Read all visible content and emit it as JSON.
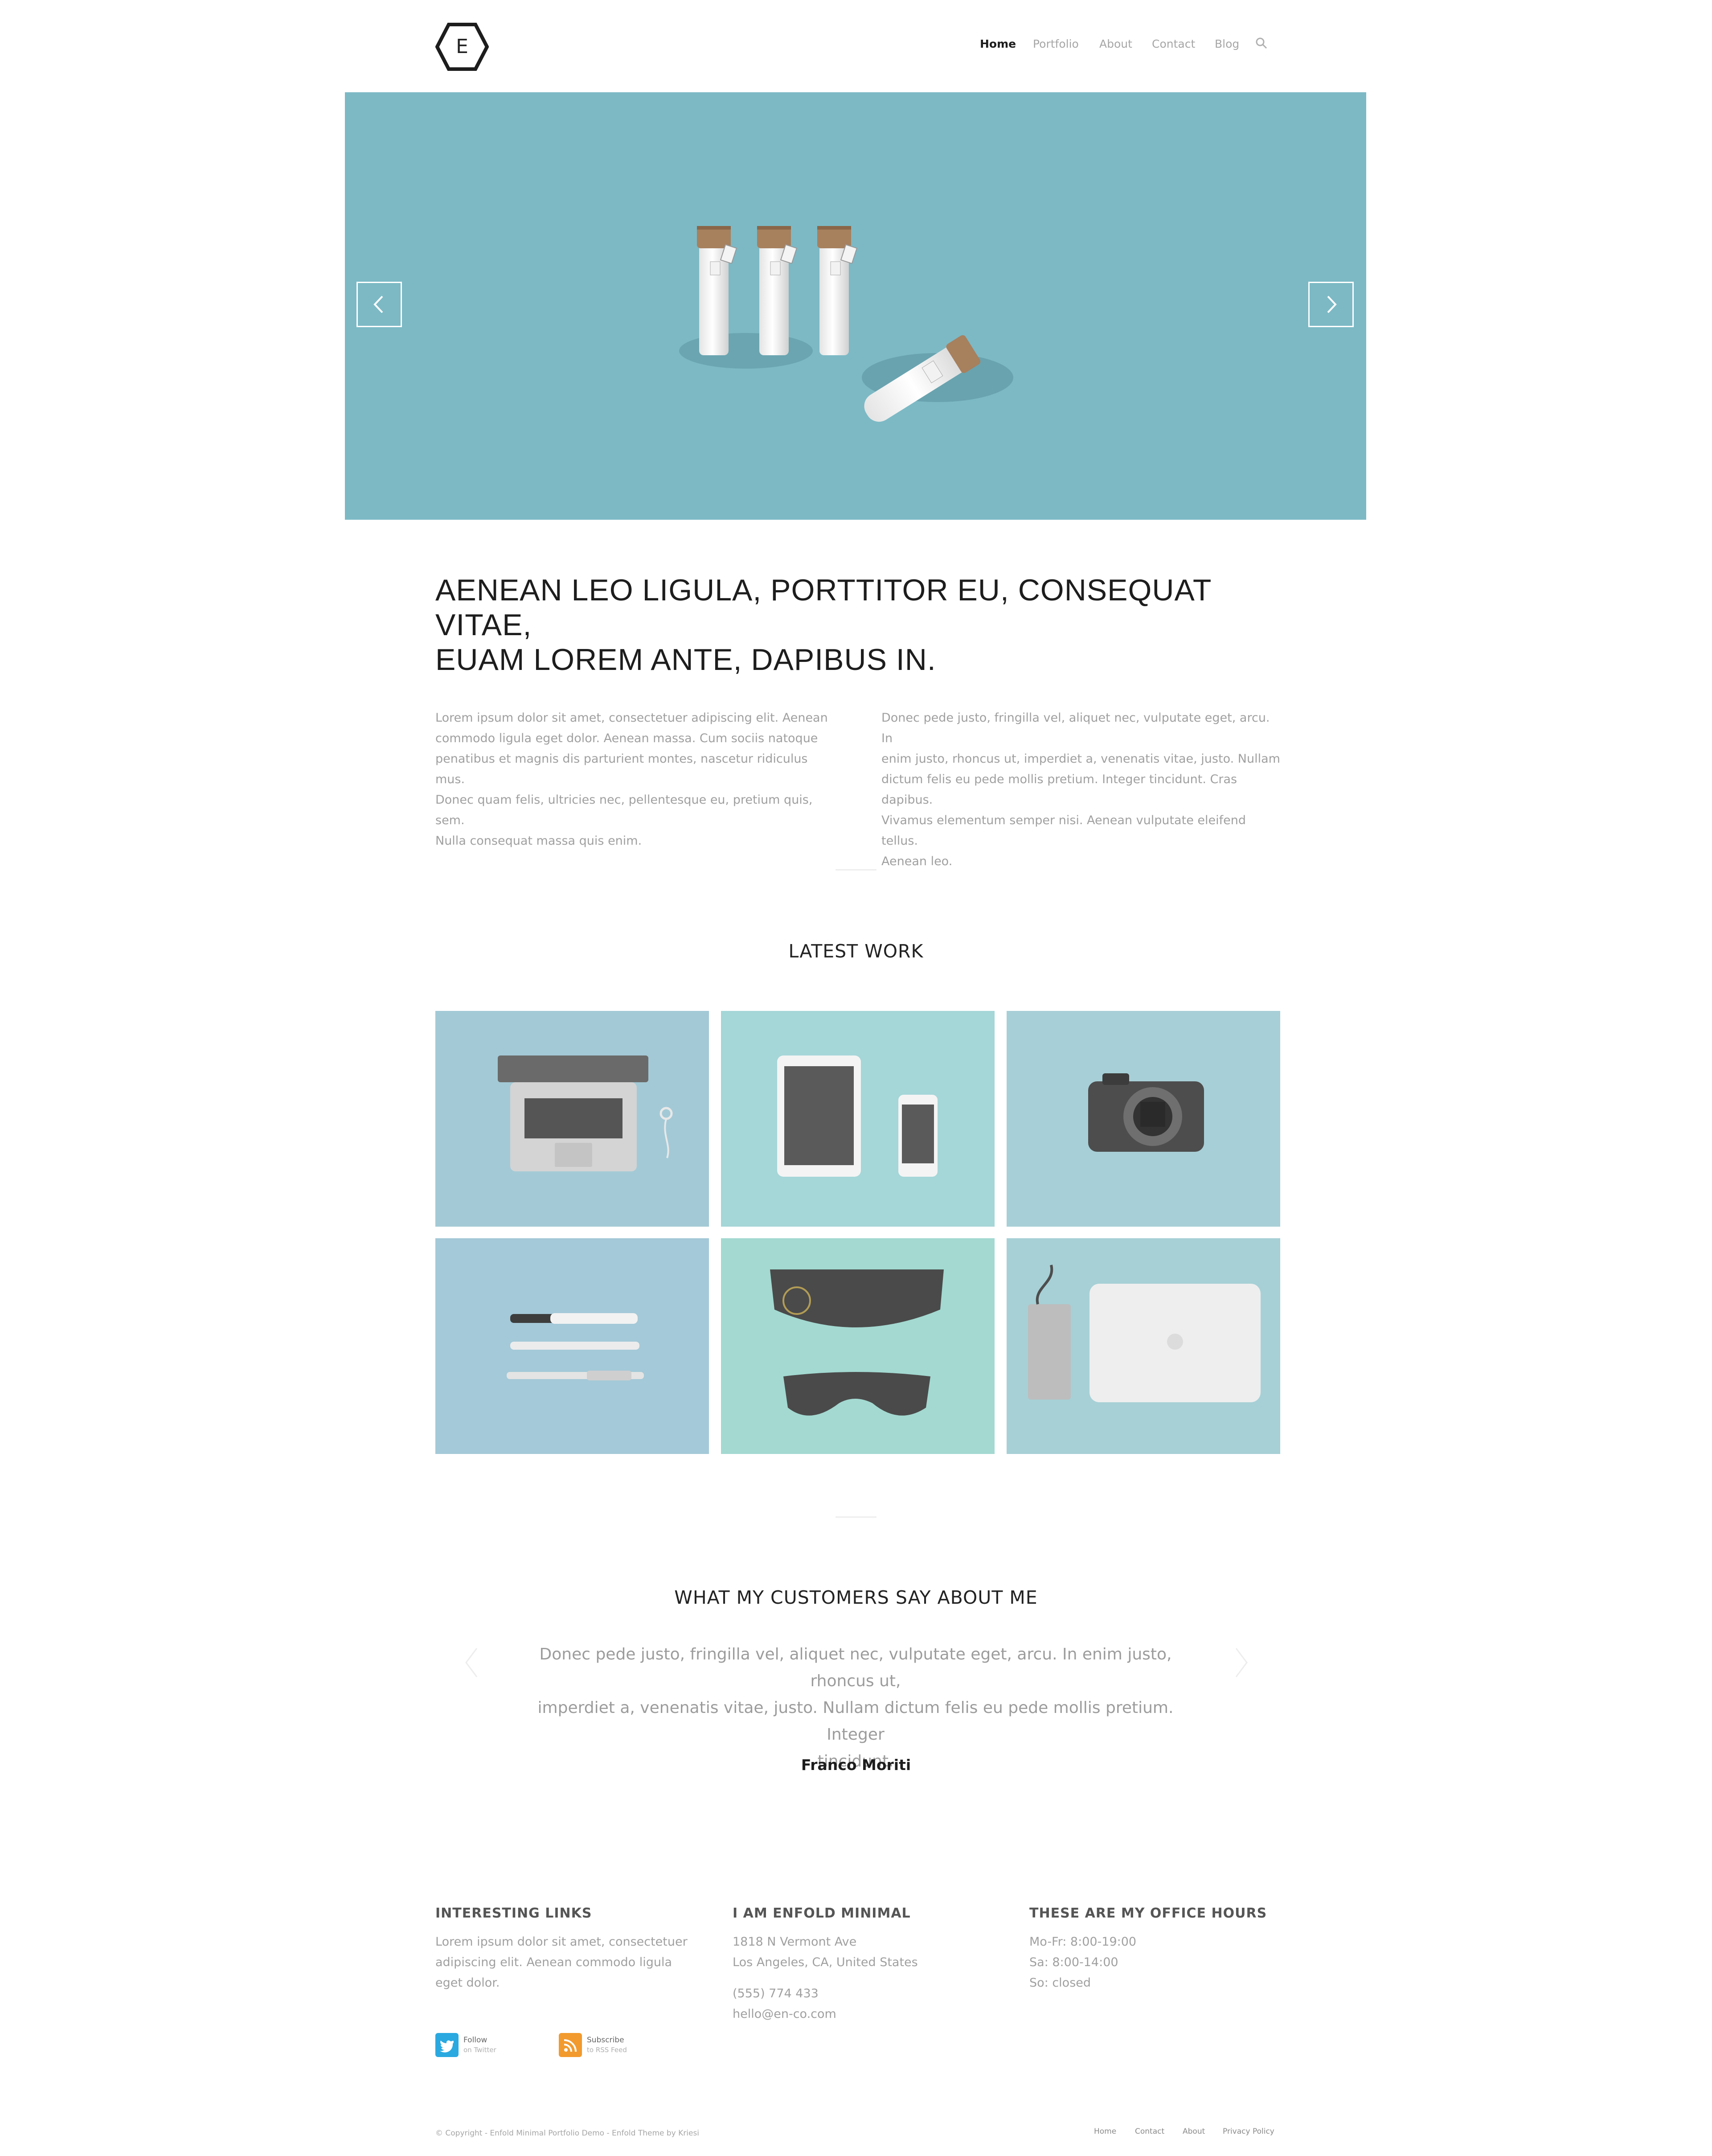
{
  "header": {
    "logo_letter": "E",
    "nav": [
      {
        "label": "Home",
        "active": true
      },
      {
        "label": "Portfolio",
        "active": false
      },
      {
        "label": "About",
        "active": false
      },
      {
        "label": "Contact",
        "active": false
      },
      {
        "label": "Blog",
        "active": false
      }
    ],
    "search_icon": "search-icon"
  },
  "slider": {
    "background_color": "#7cb9c5",
    "prev_icon": "chevron-left-icon",
    "next_icon": "chevron-right-icon",
    "slide_count": 2,
    "active_slide": 1
  },
  "intro": {
    "headline_line1": "AENEAN LEO LIGULA, PORTTITOR EU, CONSEQUAT VITAE,",
    "headline_line2": "EUAM LOREM ANTE, DAPIBUS IN.",
    "col1_lines": [
      "Lorem ipsum dolor sit amet, consectetuer adipiscing elit. Aenean",
      "commodo ligula eget dolor. Aenean massa. Cum sociis natoque",
      "penatibus et magnis dis parturient montes, nascetur ridiculus mus.",
      "Donec quam felis, ultricies nec, pellentesque eu, pretium quis, sem.",
      "Nulla consequat massa quis enim."
    ],
    "col2_lines": [
      "Donec pede justo, fringilla vel, aliquet nec, vulputate eget, arcu. In",
      "enim justo, rhoncus ut, imperdiet a, venenatis vitae, justo. Nullam",
      "dictum felis eu pede mollis pretium. Integer tincidunt. Cras dapibus.",
      "Vivamus elementum semper nisi. Aenean vulputate eleifend tellus.",
      "Aenean leo."
    ]
  },
  "latest_work": {
    "title": "LATEST WORK",
    "items": [
      {
        "icon": "laptop-icon",
        "color": "#a3c9d6"
      },
      {
        "icon": "tablet-phone-icon",
        "color": "#a5d6d8"
      },
      {
        "icon": "camera-icon",
        "color": "#a7cfd7"
      },
      {
        "icon": "pens-icon",
        "color": "#a4c9d8"
      },
      {
        "icon": "sunglasses-icon",
        "color": "#a3d9d1"
      },
      {
        "icon": "macbook-hdd-icon",
        "color": "#a6d0d6"
      }
    ]
  },
  "testimonials": {
    "title": "WHAT MY CUSTOMERS SAY ABOUT ME",
    "quote_lines": [
      "Donec pede justo, fringilla vel, aliquet nec, vulputate eget, arcu. In enim justo, rhoncus ut,",
      "imperdiet a, venenatis vitae, justo. Nullam dictum felis eu pede mollis pretium. Integer",
      "tincidunt."
    ],
    "author": "Franco Moriti"
  },
  "footer": {
    "col1": {
      "title": "INTERESTING LINKS",
      "lines": [
        "Lorem ipsum dolor sit amet, consectetuer",
        "adipiscing elit. Aenean commodo ligula",
        "eget dolor."
      ]
    },
    "col2": {
      "title": "I AM ENFOLD MINIMAL",
      "address": [
        "1818 N Vermont Ave",
        "Los Angeles, CA, United States"
      ],
      "contact": [
        "(555) 774 433",
        "hello@en-co.com"
      ]
    },
    "col3": {
      "title": "THESE ARE MY OFFICE HOURS",
      "lines": [
        "Mo-Fr: 8:00-19:00",
        "Sa: 8:00-14:00",
        "So: closed"
      ]
    },
    "social": [
      {
        "icon": "twitter-icon",
        "line1": "Follow",
        "line2": "on Twitter",
        "color": "#2aa9e0"
      },
      {
        "icon": "rss-icon",
        "line1": "Subscribe",
        "line2": "to RSS Feed",
        "color": "#f29a2e"
      }
    ],
    "copyright": "© Copyright - Enfold Minimal Portfolio Demo - Enfold Theme by Kriesi",
    "bottom_nav": [
      "Home",
      "Contact",
      "About",
      "Privacy Policy"
    ]
  }
}
